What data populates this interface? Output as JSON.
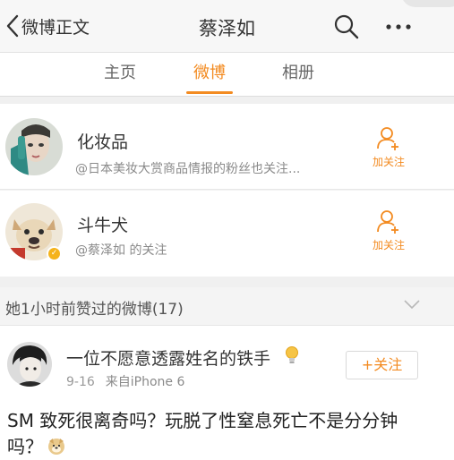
{
  "nav": {
    "back_label": "微博正文",
    "title": "蔡泽如",
    "back_icon": "chevron-left-icon",
    "search_icon": "search-icon",
    "more_icon": "more-icon"
  },
  "tabs": [
    {
      "label": "主页",
      "active": false
    },
    {
      "label": "微博",
      "active": true
    },
    {
      "label": "相册",
      "active": false
    }
  ],
  "users": [
    {
      "name": "化妆品",
      "desc": "@日本美妆大赏商品情报的粉丝也关注...",
      "follow_label": "加关注",
      "avatar_icon": "face-photo-avatar"
    },
    {
      "name": "斗牛犬",
      "desc": "@蔡泽如 的关注",
      "follow_label": "加关注",
      "avatar_icon": "bulldog-photo-avatar",
      "verified": true
    }
  ],
  "section": {
    "title": "她1小时前赞过的微博(17)",
    "chevron_icon": "chevron-down-icon"
  },
  "post": {
    "author": "一位不愿意透露姓名的铁手",
    "date": "9-16",
    "source": "来自iPhone 6",
    "follow_label": "+关注",
    "text_line1": "SM 致死很离奇吗？玩脱了性窒息死亡不是分分钟",
    "text_line2": "吗？",
    "emoji_icon": "doge-emoji-icon",
    "badge_icon": "lightbulb-icon"
  },
  "colors": {
    "accent": "#f38b21",
    "nav_bg": "#f7f7f7",
    "muted_text": "#8a8a8a"
  }
}
